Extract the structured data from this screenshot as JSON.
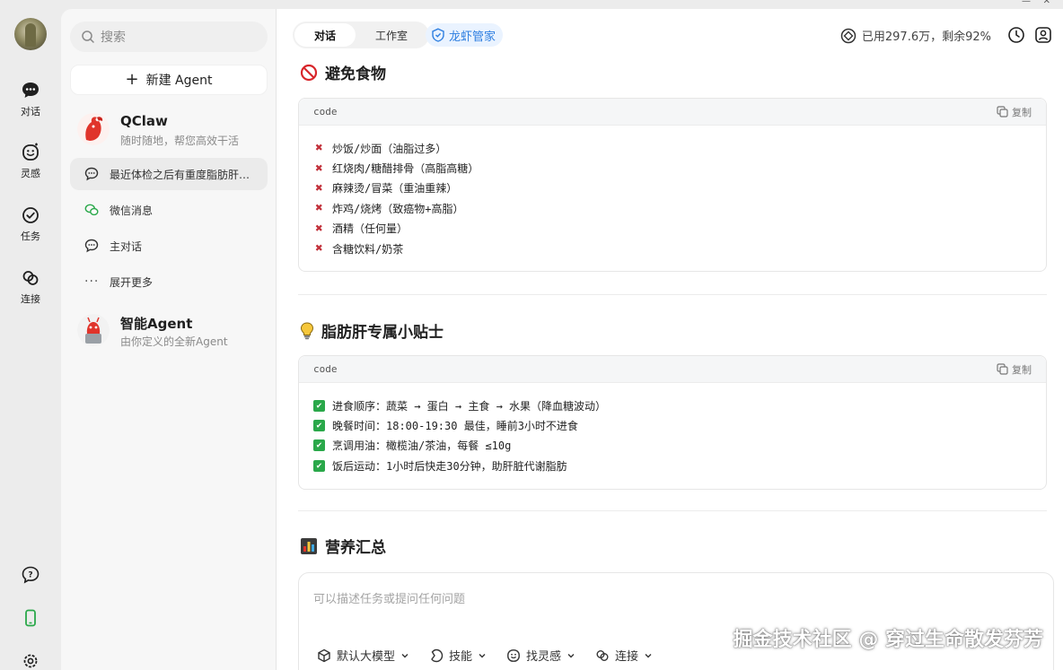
{
  "rail": {
    "items": [
      {
        "label": "对话",
        "icon": "chat-bubble-icon"
      },
      {
        "label": "灵感",
        "icon": "smile-icon"
      },
      {
        "label": "任务",
        "icon": "check-circle-icon"
      },
      {
        "label": "连接",
        "icon": "link-icon"
      }
    ],
    "bottom_icons": [
      "help-icon",
      "phone-icon",
      "settings-icon"
    ]
  },
  "sidebar": {
    "search_placeholder": "搜索",
    "new_agent_label": "新建 Agent",
    "agents": [
      {
        "name": "QClaw",
        "subtitle": "随时随地，帮您高效干活"
      },
      {
        "name": "智能Agent",
        "subtitle": "由你定义的全新Agent"
      }
    ],
    "conversations": [
      {
        "label": "最近体检之后有重度脂肪肝…",
        "icon": "chat-bubble-icon",
        "active": true
      },
      {
        "label": "微信消息",
        "icon": "wechat-icon",
        "active": false
      },
      {
        "label": "主对话",
        "icon": "chat-bubble-icon",
        "active": false
      },
      {
        "label": "展开更多",
        "icon": "more-icon",
        "active": false
      }
    ]
  },
  "header": {
    "tabs": [
      {
        "label": "对话",
        "active": true
      },
      {
        "label": "工作室",
        "active": false
      }
    ],
    "lxgj_label": "龙虾管家",
    "quota_text": "已用297.6万，剩余92%"
  },
  "content": {
    "sections": [
      {
        "title": "避免食物",
        "icon": "no-entry-icon",
        "code_lang": "code",
        "copy_label": "复制",
        "mark": "cross",
        "lines": [
          "炒饭/炒面（油脂过多）",
          "红烧肉/糖醋排骨（高脂高糖）",
          "麻辣烫/冒菜（重油重辣）",
          "炸鸡/烧烤（致癌物+高脂）",
          "酒精（任何量）",
          "含糖饮料/奶茶"
        ]
      },
      {
        "title": "脂肪肝专属小贴士",
        "icon": "light-bulb-icon",
        "code_lang": "code",
        "copy_label": "复制",
        "mark": "check",
        "lines": [
          "进食顺序：蔬菜 → 蛋白 → 主食 → 水果（降血糖波动）",
          "晚餐时间：18:00-19:30 最佳，睡前3小时不进食",
          "烹调用油：橄榄油/茶油，每餐 ≤10g",
          "饭后运动：1小时后快走30分钟，助肝脏代谢脂肪"
        ]
      },
      {
        "title": "营养汇总",
        "icon": "bar-chart-icon"
      }
    ]
  },
  "composer": {
    "placeholder": "可以描述任务或提问任何问题",
    "tools": [
      {
        "label": "默认大模型",
        "icon": "cube-icon"
      },
      {
        "label": "技能",
        "icon": "skill-icon"
      },
      {
        "label": "找灵感",
        "icon": "smile-icon"
      },
      {
        "label": "连接",
        "icon": "link-icon"
      }
    ]
  },
  "watermark": "掘金技术社区 @ 穿过生命散发芬芳",
  "colors": {
    "accent_blue": "#2f7fe0",
    "cross_red": "#c2303a",
    "check_green": "#2aa84a"
  }
}
